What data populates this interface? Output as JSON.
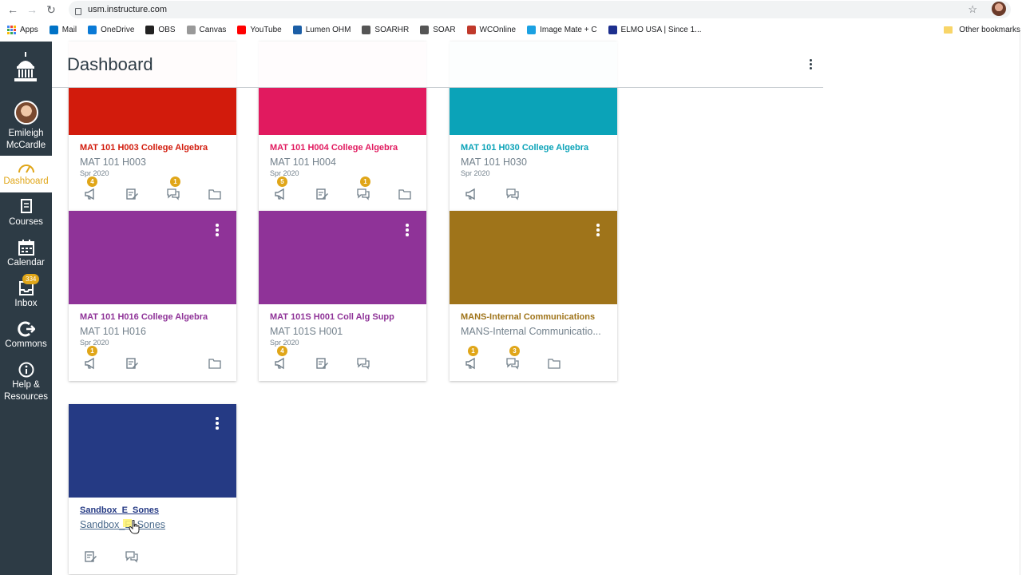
{
  "browser": {
    "url": "usm.instructure.com",
    "bookmarks": [
      {
        "label": "Apps",
        "color": "#4285f4"
      },
      {
        "label": "Mail",
        "color": "#0072c6"
      },
      {
        "label": "OneDrive",
        "color": "#0a7ad6"
      },
      {
        "label": "OBS",
        "color": "#222222"
      },
      {
        "label": "Canvas",
        "color": "#999999"
      },
      {
        "label": "YouTube",
        "color": "#ff0000"
      },
      {
        "label": "Lumen OHM",
        "color": "#1b5ea6"
      },
      {
        "label": "SOARHR",
        "color": "#555555"
      },
      {
        "label": "SOAR",
        "color": "#555555"
      },
      {
        "label": "WCOnline",
        "color": "#c0392b"
      },
      {
        "label": "Image Mate + C",
        "color": "#1ba1e2"
      },
      {
        "label": "ELMO USA | Since 1...",
        "color": "#1d2f8e"
      }
    ],
    "other_bookmarks": "Other bookmarks"
  },
  "nav": {
    "user_name": "Emileigh McCardle",
    "items": [
      {
        "label": "Dashboard",
        "icon": "dashboard-icon",
        "active": true
      },
      {
        "label": "Courses",
        "icon": "courses-icon"
      },
      {
        "label": "Calendar",
        "icon": "calendar-icon"
      },
      {
        "label": "Inbox",
        "icon": "inbox-icon",
        "badge": "334"
      },
      {
        "label": "Commons",
        "icon": "commons-icon"
      },
      {
        "label": "Help & Resources",
        "icon": "help-icon"
      }
    ]
  },
  "header": {
    "title": "Dashboard"
  },
  "cards": [
    {
      "title": "MAT 101 H003 College Algebra",
      "code": "MAT 101 H003",
      "term": "Spr 2020",
      "color": "#d21b0c",
      "actions": [
        {
          "icon": "announcements-icon",
          "badge": "4"
        },
        {
          "icon": "assignments-icon"
        },
        {
          "icon": "discussions-icon",
          "badge": "1"
        },
        {
          "icon": "files-icon"
        }
      ]
    },
    {
      "title": "MAT 101 H004 College Algebra",
      "code": "MAT 101 H004",
      "term": "Spr 2020",
      "color": "#e11a5f",
      "actions": [
        {
          "icon": "announcements-icon",
          "badge": "5"
        },
        {
          "icon": "assignments-icon"
        },
        {
          "icon": "discussions-icon",
          "badge": "1"
        },
        {
          "icon": "files-icon"
        }
      ]
    },
    {
      "title": "MAT 101 H030 College Algebra",
      "code": "MAT 101 H030",
      "term": "Spr 2020",
      "color": "#0ba3b8",
      "actions": [
        {
          "icon": "announcements-icon"
        },
        {
          "icon": "discussions-icon"
        }
      ]
    },
    {
      "title": "MAT 101 H016 College Algebra",
      "code": "MAT 101 H016",
      "term": "Spr 2020",
      "color": "#8f3398",
      "actions": [
        {
          "icon": "announcements-icon",
          "badge": "1"
        },
        {
          "icon": "assignments-icon"
        },
        {
          "icon": "files-icon"
        }
      ]
    },
    {
      "title": "MAT 101S H001 Coll Alg Supp",
      "code": "MAT 101S H001",
      "term": "Spr 2020",
      "color": "#8f3398",
      "actions": [
        {
          "icon": "announcements-icon",
          "badge": "4"
        },
        {
          "icon": "assignments-icon"
        },
        {
          "icon": "discussions-icon"
        }
      ]
    },
    {
      "title": "MANS-Internal Communications",
      "code": "MANS-Internal Communicatio...",
      "term": "",
      "color": "#9f741a",
      "actions": [
        {
          "icon": "announcements-icon",
          "badge": "1"
        },
        {
          "icon": "discussions-icon",
          "badge": "3"
        },
        {
          "icon": "files-icon"
        }
      ]
    },
    {
      "title": "Sandbox_E_Sones",
      "code": "Sandbox_E_Sones",
      "term": "",
      "color": "#253a84",
      "actions": [
        {
          "icon": "assignments-icon"
        },
        {
          "icon": "discussions-icon"
        }
      ]
    }
  ]
}
